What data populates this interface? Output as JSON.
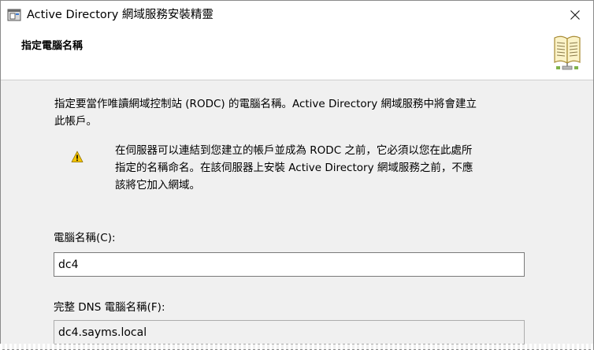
{
  "window": {
    "title": "Active Directory 網域服務安裝精靈"
  },
  "header": {
    "title": "指定電腦名稱"
  },
  "main": {
    "description": "指定要當作唯讀網域控制站 (RODC) 的電腦名稱。Active Directory 網域服務中將會建立\n此帳戶。",
    "warning": "在伺服器可以連結到您建立的帳戶並成為 RODC 之前，它必須以您在此處所\n指定的名稱命名。在該伺服器上安裝 Active Directory 網域服務之前，不應\n該將它加入網域。",
    "computer_name": {
      "label": "電腦名稱(C):",
      "value": "dc4"
    },
    "dns_name": {
      "label": "完整 DNS 電腦名稱(F):",
      "value": "dc4.sayms.local"
    }
  },
  "icons": {
    "app": "server-manager-icon",
    "close": "close-icon",
    "header": "book-icon",
    "warning": "warning-icon"
  },
  "colors": {
    "warning_yellow": "#f5c400",
    "window_bg": "#f0f0f0"
  }
}
